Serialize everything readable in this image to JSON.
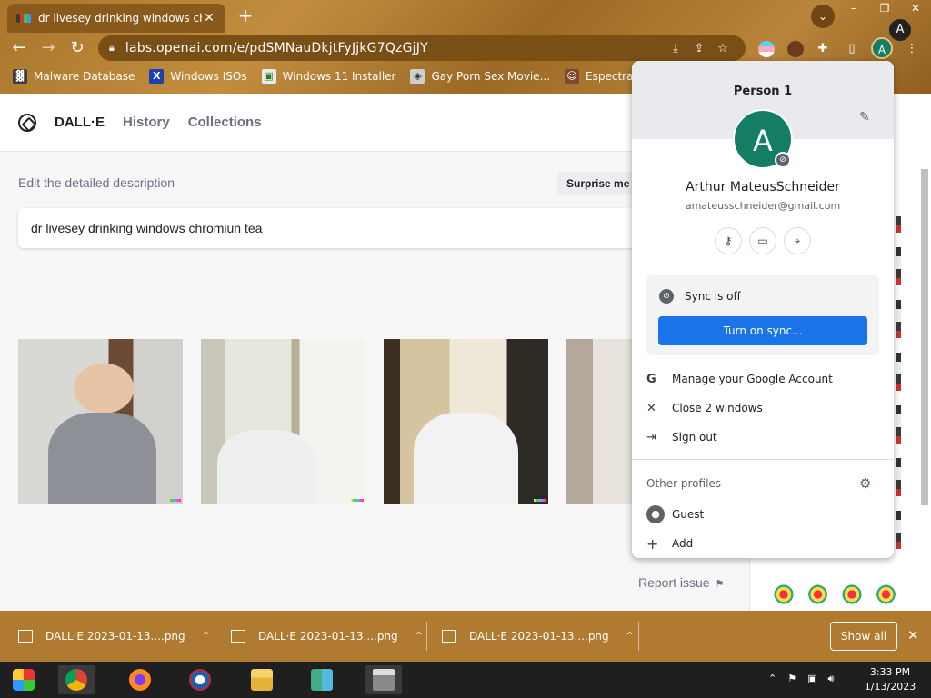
{
  "browser": {
    "tab_title": "dr livesey drinking windows chromiun tea",
    "url": "labs.openai.com/e/pdSMNauDkjtFyJjkG7QzGjJY",
    "window_controls": [
      "–",
      "❐",
      "✕"
    ]
  },
  "bookmarks": [
    {
      "label": "Malware Database",
      "icon": "malware-icon",
      "color": "#3b3b3b"
    },
    {
      "label": "Windows ISOs",
      "icon": "x-icon",
      "color": "#1e3fb0"
    },
    {
      "label": "Windows 11 Installer",
      "icon": "image-icon",
      "color": "#eaeaea"
    },
    {
      "label": "Gay Porn Sex Movie...",
      "icon": "box-icon",
      "color": "#cfcfcf"
    },
    {
      "label": "Espectral McGee",
      "icon": "face-icon",
      "color": "#7a4a2a"
    }
  ],
  "site": {
    "brand": "DALL·E",
    "nav": [
      "History",
      "Collections"
    ],
    "desc_label": "Edit the detailed description",
    "surprise_label": "Surprise me",
    "prompt": "dr livesey drinking windows chromiun tea",
    "report_issue": "Report issue",
    "avatar_letter": "A"
  },
  "profile_popup": {
    "person": "Person 1",
    "avatar_letter": "A",
    "name": "Arthur MateusSchneider",
    "email": "amateusschneider@gmail.com",
    "sync_status": "Sync is off",
    "sync_button": "Turn on sync...",
    "rows": [
      {
        "label": "Manage your Google Account",
        "icon": "google-icon"
      },
      {
        "label": "Close 2 windows",
        "icon": "close-icon"
      },
      {
        "label": "Sign out",
        "icon": "sign-out-icon"
      }
    ],
    "other_profiles": "Other profiles",
    "guest": "Guest",
    "add": "Add"
  },
  "downloads": {
    "items": [
      "DALL·E 2023-01-13....png",
      "DALL·E 2023-01-13....png",
      "DALL·E 2023-01-13....png"
    ],
    "show_all": "Show all"
  },
  "taskbar": {
    "time": "3:33 PM",
    "date": "1/13/2023"
  }
}
